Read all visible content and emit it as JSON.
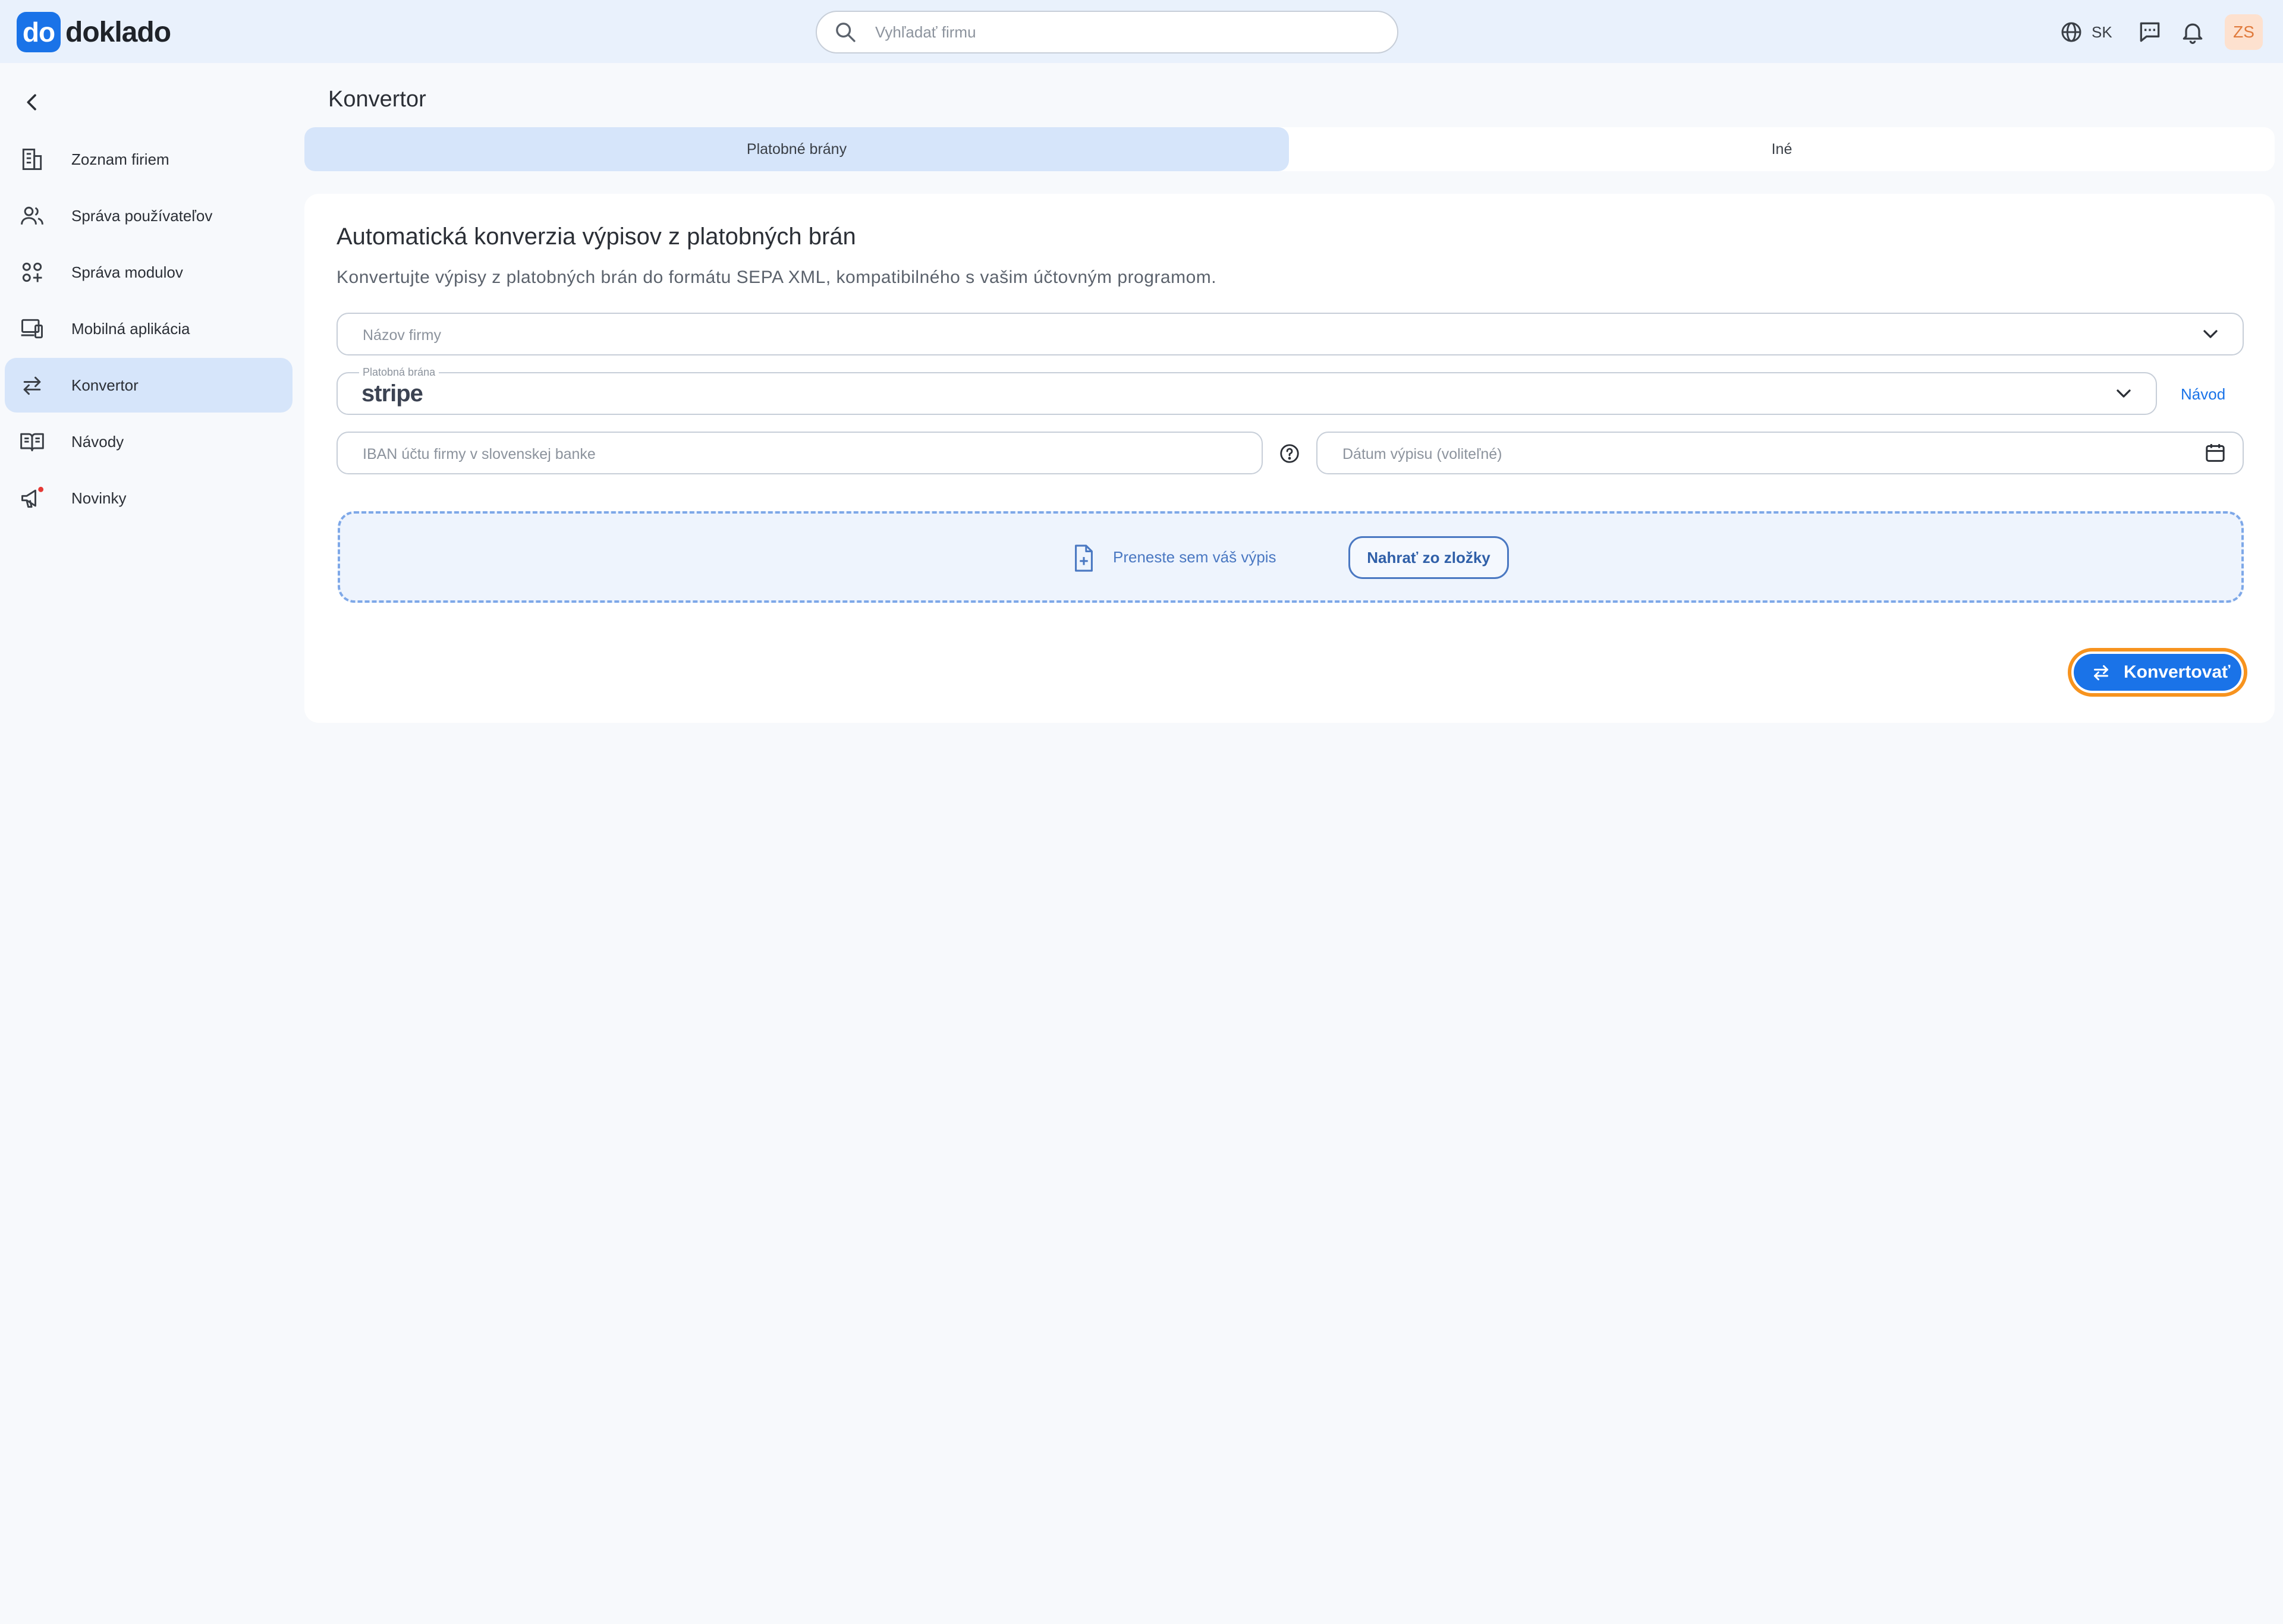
{
  "app": {
    "logo_mark": "do",
    "logo_text": "doklado"
  },
  "header": {
    "search_placeholder": "Vyhľadať firmu",
    "language": "SK",
    "avatar_initials": "ZS"
  },
  "sidebar": {
    "items": [
      {
        "label": "Zoznam firiem",
        "icon": "building-icon",
        "active": false
      },
      {
        "label": "Správa používateľov",
        "icon": "users-icon",
        "active": false
      },
      {
        "label": "Správa modulov",
        "icon": "modules-icon",
        "active": false
      },
      {
        "label": "Mobilná aplikácia",
        "icon": "devices-icon",
        "active": false
      },
      {
        "label": "Konvertor",
        "icon": "convert-arrows-icon",
        "active": true
      },
      {
        "label": "Návody",
        "icon": "book-icon",
        "active": false
      },
      {
        "label": "Novinky",
        "icon": "megaphone-icon",
        "active": false
      }
    ]
  },
  "main": {
    "page_title": "Konvertor",
    "tabs": [
      {
        "label": "Platobné brány",
        "active": true
      },
      {
        "label": "Iné",
        "active": false
      }
    ],
    "card": {
      "title": "Automatická konverzia výpisov z platobných brán",
      "subtitle": "Konvertujte výpisy z platobných brán do formátu SEPA XML, kompatibilného s vašim účtovným programom.",
      "company_placeholder": "Názov firmy",
      "gateway_label": "Platobná brána",
      "gateway_value": "stripe",
      "guide_link": "Návod",
      "iban_placeholder": "IBAN účtu firmy v slovenskej banke",
      "date_placeholder": "Dátum výpisu (voliteľné)",
      "drop_text": "Preneste sem váš výpis",
      "upload_button": "Nahrať zo zložky",
      "convert_button": "Konvertovať"
    }
  },
  "colors": {
    "accent": "#1a73e8",
    "active_bg": "#d6e5fa",
    "focus_ring": "#f7931e",
    "notification_dot": "#e53935"
  }
}
